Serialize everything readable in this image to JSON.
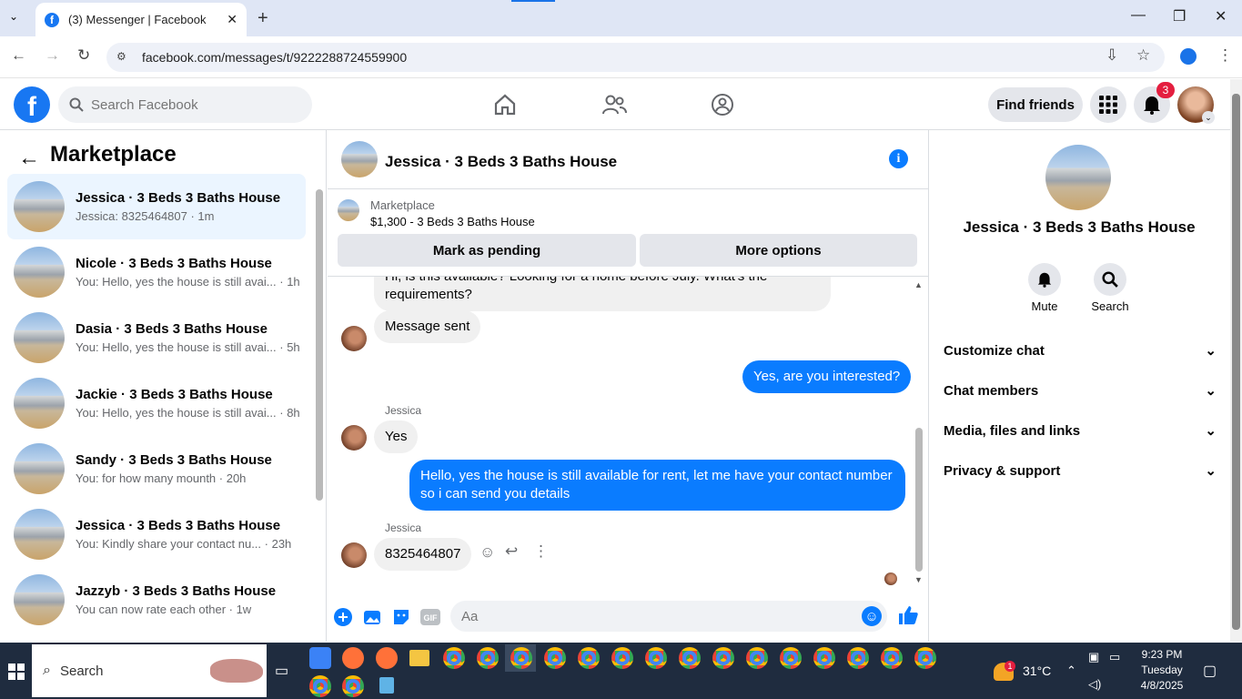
{
  "browser": {
    "tab_title": "(3) Messenger | Facebook",
    "url": "facebook.com/messages/t/9222288724559900"
  },
  "fb_header": {
    "search_placeholder": "Search Facebook",
    "find_friends": "Find friends",
    "notif_count": "3"
  },
  "left": {
    "title": "Marketplace",
    "conversations": [
      {
        "name": "Jessica · 3 Beds 3 Baths House",
        "preview": "Jessica: 8325464807 · 1m"
      },
      {
        "name": "Nicole · 3 Beds 3 Baths House",
        "preview": "You: Hello, yes the house is still avai... · 1h"
      },
      {
        "name": "Dasia · 3 Beds 3 Baths House",
        "preview": "You: Hello, yes the house is still avai... · 5h"
      },
      {
        "name": "Jackie · 3 Beds 3 Baths House",
        "preview": "You: Hello, yes the house is still avai... · 8h"
      },
      {
        "name": "Sandy · 3 Beds 3 Baths House",
        "preview": "You: for how many mounth · 20h"
      },
      {
        "name": "Jessica · 3 Beds 3 Baths House",
        "preview": "You: Kindly share your contact nu... · 23h"
      },
      {
        "name": "Jazzyb · 3 Beds 3 Baths House",
        "preview": "You can now rate each other · 1w"
      }
    ]
  },
  "chat": {
    "title": "Jessica · 3 Beds 3 Baths House",
    "listing_label": "Marketplace",
    "listing_price": "$1,300 - 3 Beds 3 Baths House",
    "mark_pending": "Mark as pending",
    "more_options": "More options",
    "messages": {
      "m1": "Hi, is this available? Looking for a home before July. What's the requirements?",
      "m2": "Message sent",
      "m3": "Yes, are you interested?",
      "sender": "Jessica",
      "m4": "Yes",
      "m5": "Hello, yes the house is still available for rent, let me have your contact number so i can send you  details",
      "m6": "8325464807"
    },
    "composer_placeholder": "Aa"
  },
  "right": {
    "title": "Jessica · 3 Beds 3 Baths House",
    "mute": "Mute",
    "search": "Search",
    "sections": [
      "Customize chat",
      "Chat members",
      "Media, files and links",
      "Privacy & support"
    ]
  },
  "taskbar": {
    "search": "Search",
    "weather": "31°C",
    "weather_badge": "1",
    "time": "9:23 PM",
    "day": "Tuesday",
    "date": "4/8/2025"
  }
}
